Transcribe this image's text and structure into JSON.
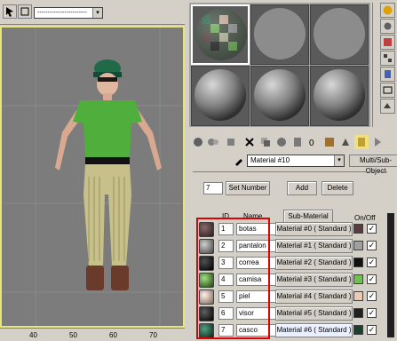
{
  "toolbar": {
    "dropdown_value": "------------------------"
  },
  "ruler": {
    "ticks": [
      "40",
      "50",
      "60",
      "70"
    ]
  },
  "material": {
    "name": "Material #10",
    "type": "Multi/Sub-Object",
    "count": "7",
    "set_number_label": "Set Number",
    "add_label": "Add",
    "delete_label": "Delete",
    "headers": {
      "id": "ID",
      "name": "Name",
      "sub_material": "Sub-Material",
      "on_off": "On/Off"
    },
    "rows": [
      {
        "id": "1",
        "name": "botas",
        "sub": "Material #0  ( Standard )",
        "color": "#5a3a3a"
      },
      {
        "id": "2",
        "name": "pantalon",
        "sub": "Material #1  ( Standard )",
        "color": "#a0a0a0"
      },
      {
        "id": "3",
        "name": "correa",
        "sub": "Material #2  ( Standard )",
        "color": "#101010"
      },
      {
        "id": "4",
        "name": "camisa",
        "sub": "Material #3  ( Standard )",
        "color": "#70c050"
      },
      {
        "id": "5",
        "name": "piel",
        "sub": "Material #4  ( Standard )",
        "color": "#f0c8b0"
      },
      {
        "id": "6",
        "name": "visor",
        "sub": "Material #5  ( Standard )",
        "color": "#202020"
      },
      {
        "id": "7",
        "name": "casco",
        "sub": "Material #6  ( Standard )",
        "color": "#1a4030"
      }
    ]
  }
}
